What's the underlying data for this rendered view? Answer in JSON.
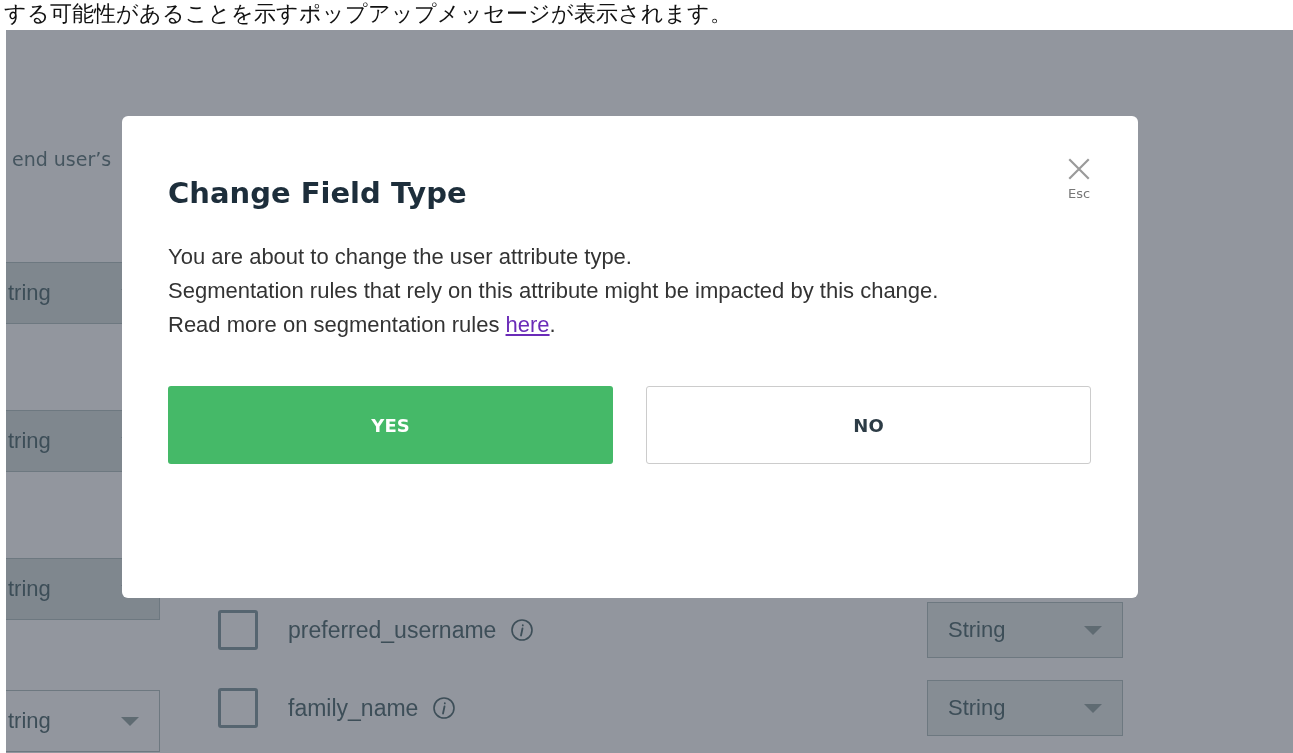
{
  "caption": "する可能性があることを示すポップアップメッセージが表示されます。",
  "background": {
    "description_fragment": "end user’s",
    "left_selects": [
      {
        "value": "tring"
      },
      {
        "value": "tring"
      },
      {
        "value": "tring"
      },
      {
        "value": "tring"
      }
    ],
    "attributes": [
      {
        "name": "preferred_username",
        "checked": false,
        "type": "String"
      },
      {
        "name": "family_name",
        "checked": false,
        "type": "String"
      }
    ]
  },
  "dialog": {
    "title": "Change Field Type",
    "close_hint": "Esc",
    "lines": [
      "You are about to change the user attribute type.",
      "Segmentation rules that rely on this attribute might be impacted by this change."
    ],
    "link_line": {
      "before": "Read more on segmentation rules ",
      "link": "here",
      "after": "."
    },
    "buttons": [
      {
        "label": "YES",
        "kind": "primary"
      },
      {
        "label": "NO",
        "kind": "secondary"
      }
    ]
  }
}
